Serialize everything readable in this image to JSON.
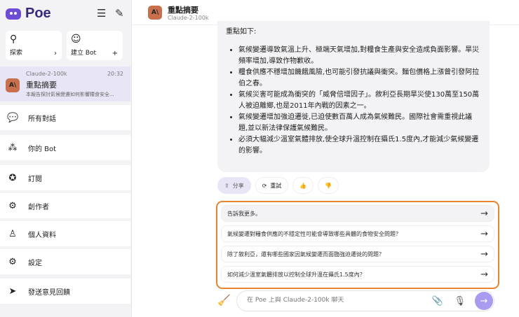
{
  "app": {
    "name": "Poe"
  },
  "sidebar": {
    "explore": "探索",
    "create_bot": "建立 Bot",
    "chat": {
      "bot": "Claude-2-100k",
      "time": "20:32",
      "title": "重點摘要",
      "preview": "本報告探討氣候變遷如何影響糧食安全..."
    },
    "items": [
      {
        "label": "所有對話"
      },
      {
        "label": "你的 Bot"
      },
      {
        "label": "訂閱"
      },
      {
        "label": "創作者"
      },
      {
        "label": "個人資料"
      },
      {
        "label": "設定"
      },
      {
        "label": "發送意見回饋"
      }
    ]
  },
  "header": {
    "title": "重點摘要",
    "bot": "Claude-2-100k",
    "avatar": "A\\"
  },
  "message": {
    "intro": "重點如下:",
    "bullets": [
      "氣候變遷導致氣溫上升、極端天氣增加,對糧食生產與安全造成負面影響。旱災頻率增加,導致作物歉收。",
      "糧食供應不穩增加饑餓風險,也可能引發抗議與衝突。麵包價格上漲曾引發阿拉伯之春。",
      "氣候災害可能成為衝突的「威脅倍增因子」。敘利亞長期旱災使130萬至150萬人被迫離鄉,也是2011年內戰的因素之一。",
      "氣候變遷增加強迫遷徙,已迫使數百萬人成為氣候難民。國際社會需重視此議題,並以新法律保護氣候難民。",
      "必須大幅減少溫室氣體排放,使全球升溫控制在攝氏1.5度內,才能減少氣候變遷的影響。"
    ]
  },
  "actions": {
    "share": "分享",
    "retry": "重試"
  },
  "suggestions": [
    "告訴我更多。",
    "氣候變遷對糧食供應的不穩定性可能會導致哪些具體的食物安全問題？",
    "除了敘利亞，還有哪些國家因氣候變遷而面臨強迫遷徙的問題？",
    "如何減少溫室氣體排放以控制全球升溫在攝氏1.5度內？"
  ],
  "input": {
    "placeholder": "在 Poe 上與 Claude-2-100k 聊天"
  },
  "colors": {
    "accent": "#6d4cd6",
    "highlight": "#e8832f"
  }
}
